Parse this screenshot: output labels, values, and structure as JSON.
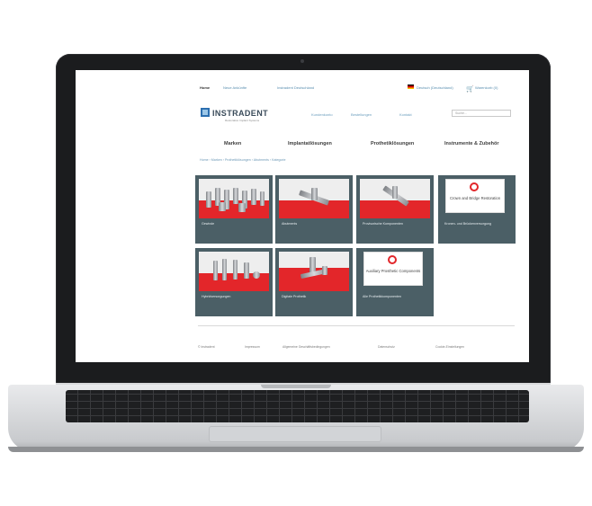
{
  "topbar": {
    "home_label": "Home",
    "link1": "Neue Ankünfte",
    "link2": "Instradent Deutschland",
    "language_label": "Deutsch (Deutschland)",
    "cart_label": "Warenkorb (0)"
  },
  "header": {
    "brand": "INSTRADENT",
    "tagline": "Restorative Implant Systems",
    "links": [
      "Kundenkonto",
      "Bestellungen",
      "Kontakt"
    ],
    "search_placeholder": "Suche..."
  },
  "nav": {
    "items": [
      "Marken",
      "Implantatlösungen",
      "Prothetiklösungen",
      "Instrumente & Zubehör"
    ]
  },
  "breadcrumb": "Home › Marken › Prothetiklösungen › Abutments › Kategorie",
  "tiles": [
    {
      "caption": "Gewinde",
      "image": "photo",
      "placeholder": ""
    },
    {
      "caption": "Abutments",
      "image": "photo",
      "placeholder": ""
    },
    {
      "caption": "Provisorische Komponenten",
      "image": "photo",
      "placeholder": ""
    },
    {
      "caption": "Kronen- und Brückenversorgung",
      "image": "placeholder",
      "placeholder": "Crown and Bridge Restoration"
    },
    {
      "caption": "Hybridversorgungen",
      "image": "photo",
      "placeholder": ""
    },
    {
      "caption": "Digitale Prothetik",
      "image": "photo",
      "placeholder": ""
    },
    {
      "caption": "Alle Prothetikkomponenten",
      "image": "placeholder",
      "placeholder": "Auxiliary Prosthetic Components"
    }
  ],
  "footer": {
    "links": [
      "© Instradent",
      "Impressum",
      "Allgemeine Geschäftsbedingungen",
      "Datenschutz",
      "Cookie-Einstellungen"
    ]
  },
  "colors": {
    "accent_red": "#e3262a",
    "tile_bg": "#4b5f66",
    "link_blue": "#6a9dbd"
  }
}
